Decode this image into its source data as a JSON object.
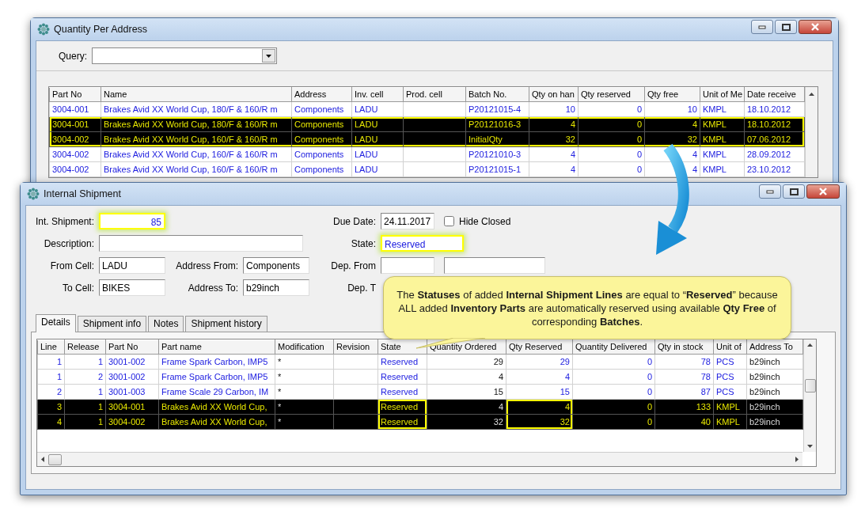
{
  "quantity_window": {
    "title": "Quantity Per Address",
    "query": {
      "label": "Query:"
    },
    "table": {
      "columns": [
        {
          "label": "Part No",
          "kind": "text"
        },
        {
          "label": "Name",
          "kind": "text"
        },
        {
          "label": "Address",
          "kind": "text"
        },
        {
          "label": "Inv. cell",
          "kind": "text"
        },
        {
          "label": "Prod. cell",
          "kind": "text"
        },
        {
          "label": "Batch No.",
          "kind": "text"
        },
        {
          "label": "Qty on han",
          "kind": "number"
        },
        {
          "label": "Qty reserved",
          "kind": "number"
        },
        {
          "label": "Qty free",
          "kind": "number"
        },
        {
          "label": "Unit of Me",
          "kind": "text"
        },
        {
          "label": "Date receive",
          "kind": "text"
        }
      ],
      "rows": [
        {
          "selected": false,
          "highlighted": false,
          "cells": [
            "3004-001",
            "Brakes Avid XX World Cup, 180/F & 160/R m",
            "Components",
            "LADU",
            null,
            "P20121015-4",
            "10",
            "0",
            "10",
            "KMPL",
            "18.10.2012"
          ]
        },
        {
          "selected": true,
          "highlighted": true,
          "cells": [
            "3004-001",
            "Brakes Avid XX World Cup, 180/F & 160/R m",
            "Components",
            "LADU",
            null,
            "P20121016-3",
            "4",
            "0",
            "4",
            "KMPL",
            "18.10.2012"
          ]
        },
        {
          "selected": true,
          "highlighted": true,
          "cells": [
            "3004-002",
            "Brakes Avid XX World Cup, 160/F & 160/R m",
            "Components",
            "LADU",
            null,
            "InitialQty",
            "32",
            "0",
            "32",
            "KMPL",
            "07.06.2012"
          ]
        },
        {
          "selected": false,
          "highlighted": false,
          "cells": [
            "3004-002",
            "Brakes Avid XX World Cup, 160/F & 160/R m",
            "Components",
            "LADU",
            null,
            "P20121010-3",
            "4",
            "0",
            "4",
            "KMPL",
            "28.09.2012"
          ]
        },
        {
          "selected": false,
          "highlighted": false,
          "cells": [
            "3004-002",
            "Brakes Avid XX World Cup, 160/F & 160/R m",
            "Components",
            "LADU",
            null,
            "P20121015-1",
            "4",
            "0",
            "4",
            "KMPL",
            "23.10.2012"
          ]
        }
      ]
    }
  },
  "shipment_window": {
    "title": "Internal Shipment",
    "form_rows": [
      [
        {
          "kind": "number",
          "label": "Int. Shipment:",
          "value": "85",
          "highlighted": true
        },
        null,
        {
          "kind": "date",
          "label": "Due Date:",
          "value": "24.11.2017",
          "highlighted": false,
          "option": {
            "label": "Hide Closed",
            "checked": false
          }
        }
      ],
      [
        {
          "kind": "wide",
          "label": "Description:",
          "highlighted": false
        },
        null,
        {
          "kind": "status",
          "label": "State:",
          "value": "Reserved",
          "highlighted": true
        }
      ],
      [
        {
          "kind": "text",
          "label": "From Cell:",
          "value": "LADU",
          "highlighted": false
        },
        {
          "kind": "text",
          "label": "Address From:",
          "value": "Components",
          "highlighted": false
        },
        {
          "kind": "pair",
          "label": "Dep. From",
          "highlighted": false
        }
      ],
      [
        {
          "kind": "text",
          "label": "To Cell:",
          "value": "BIKES",
          "highlighted": false
        },
        {
          "kind": "text",
          "label": "Address To:",
          "value": "b29inch",
          "highlighted": false
        },
        {
          "kind": "hidden",
          "label": "Dep. T"
        }
      ]
    ],
    "tabs": [
      {
        "label": "Details",
        "selected": true
      },
      {
        "label": "Shipment info",
        "selected": false
      },
      {
        "label": "Notes",
        "selected": false
      },
      {
        "label": "Shipment history",
        "selected": false
      }
    ],
    "table": {
      "columns": [
        {
          "label": "Line",
          "kind": "number"
        },
        {
          "label": "Release",
          "kind": "number"
        },
        {
          "label": "Part No",
          "kind": "text"
        },
        {
          "label": "Part name",
          "kind": "text"
        },
        {
          "label": "Modification",
          "kind": "plain"
        },
        {
          "label": "Revision",
          "kind": "plain"
        },
        {
          "label": "State",
          "kind": "text"
        },
        {
          "label": "Quantity Ordered",
          "kind": "count"
        },
        {
          "label": "Qty Reserved",
          "kind": "number"
        },
        {
          "label": "Quantity Delivered",
          "kind": "number"
        },
        {
          "label": "Qty in stock",
          "kind": "number"
        },
        {
          "label": "Unit of",
          "kind": "text"
        },
        {
          "label": "Address To",
          "kind": "plain"
        }
      ],
      "rows": [
        {
          "selected": false,
          "cells": [
            "1",
            "1",
            "3001-002",
            "Frame Spark Carbon, IMP5",
            "*",
            null,
            "Reserved",
            "29",
            "29",
            "0",
            "78",
            "PCS",
            "b29inch"
          ]
        },
        {
          "selected": false,
          "cells": [
            "1",
            "2",
            "3001-002",
            "Frame Spark Carbon, IMP5",
            "*",
            null,
            "Reserved",
            "4",
            "4",
            "0",
            "78",
            "PCS",
            "b29inch"
          ]
        },
        {
          "selected": false,
          "cells": [
            "2",
            "1",
            "3001-003",
            "Frame Scale 29 Carbon, IM",
            "*",
            null,
            "Reserved",
            "15",
            "15",
            "0",
            "87",
            "PCS",
            "b29inch"
          ]
        },
        {
          "selected": true,
          "cells": [
            "3",
            "1",
            "3004-001",
            "Brakes Avid XX World Cup,",
            "*",
            null,
            {
              "text": "Reserved",
              "highlighted": true
            },
            "4",
            {
              "text": "4",
              "highlighted": true
            },
            "0",
            "133",
            "KMPL",
            "b29inch"
          ]
        },
        {
          "selected": true,
          "cells": [
            "4",
            "1",
            "3004-002",
            "Brakes Avid XX World Cup,",
            "*",
            null,
            {
              "text": "Reserved",
              "highlighted": true
            },
            "32",
            {
              "text": "32",
              "highlighted": true
            },
            "0",
            "40",
            "KMPL",
            "b29inch"
          ]
        }
      ]
    }
  },
  "callout": {
    "text": "The **Statuses** of added **Internal Shipment Lines** are equal to “**Reserved**” because ALL added **Inventory Parts** are automatically reserved using available **Qty Free** of corresponding **Batches**."
  }
}
